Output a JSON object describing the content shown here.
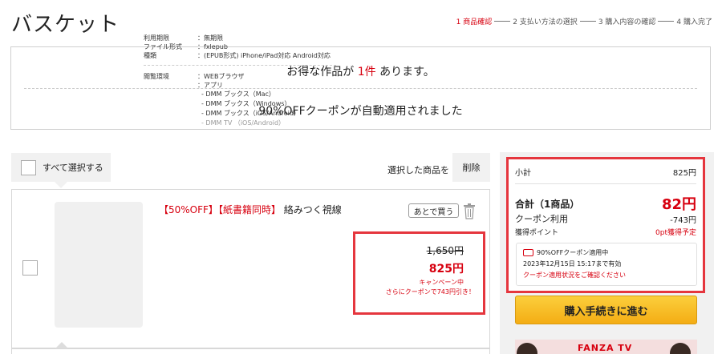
{
  "page": {
    "title": "バスケット"
  },
  "steps": [
    {
      "label": "1 商品確認",
      "active": true
    },
    {
      "label": "2 支払い方法の選択",
      "active": false
    },
    {
      "label": "3 購入内容の確認",
      "active": false
    },
    {
      "label": "4 購入完了",
      "active": false
    }
  ],
  "notice": {
    "deals_prefix": "お得な作品が",
    "deals_count": "1件",
    "deals_suffix": "あります。",
    "coupon_message": "90%OFFクーポンが自動適用されました"
  },
  "toolbar": {
    "select_all_label": "すべて選択する",
    "selected_items_label": "選択した商品を",
    "delete_label": "削除"
  },
  "item": {
    "tag_discount": "【50%OFF】",
    "tag_simul": "【紙書籍同時】",
    "name": "絡みつく視線",
    "later_label": "あとで買う",
    "details": [
      {
        "key": "利用期限",
        "value": "：無期限"
      },
      {
        "key": "ファイル形式",
        "value": "：fxlepub"
      },
      {
        "key": "種類",
        "value": "：(EPUB形式) iPhone/iPad対応 Android対応"
      }
    ],
    "env_key": "閲覧環境",
    "env_values": [
      "：WEBブラウザ",
      "：アプリ"
    ],
    "env_apps": [
      "- DMM ブックス（Mac）",
      "- DMM ブックス（Windows）",
      "- DMM ブックス（iOS/Android）"
    ],
    "env_apps_disabled": [
      "- DMM TV （iOS/Android）"
    ],
    "original_price": "1,650円",
    "price": "825円",
    "campaign_label": "キャンペーン中",
    "coupon_discount_label": "さらにクーポンで743円引き！"
  },
  "summary": {
    "subtotal_label": "小計",
    "subtotal_value": "825円",
    "total_label": "合計（1商品）",
    "total_value": "82円",
    "coupon_label": "クーポン利用",
    "coupon_value": "-743円",
    "points_label": "獲得ポイント",
    "points_value": "0pt獲得予定",
    "coupon_applied": "90%OFFクーポン適用中",
    "coupon_expiry": "2023年12月15日 15:17まで有効",
    "coupon_check_link": "クーポン適用状況をご確認ください",
    "buy_button": "購入手続きに進む"
  },
  "banner": {
    "text": "FANZA TV"
  },
  "colors": {
    "accent_red": "#d7000f",
    "highlight_border": "#e5363e",
    "buy_button": "#f4ad14"
  }
}
